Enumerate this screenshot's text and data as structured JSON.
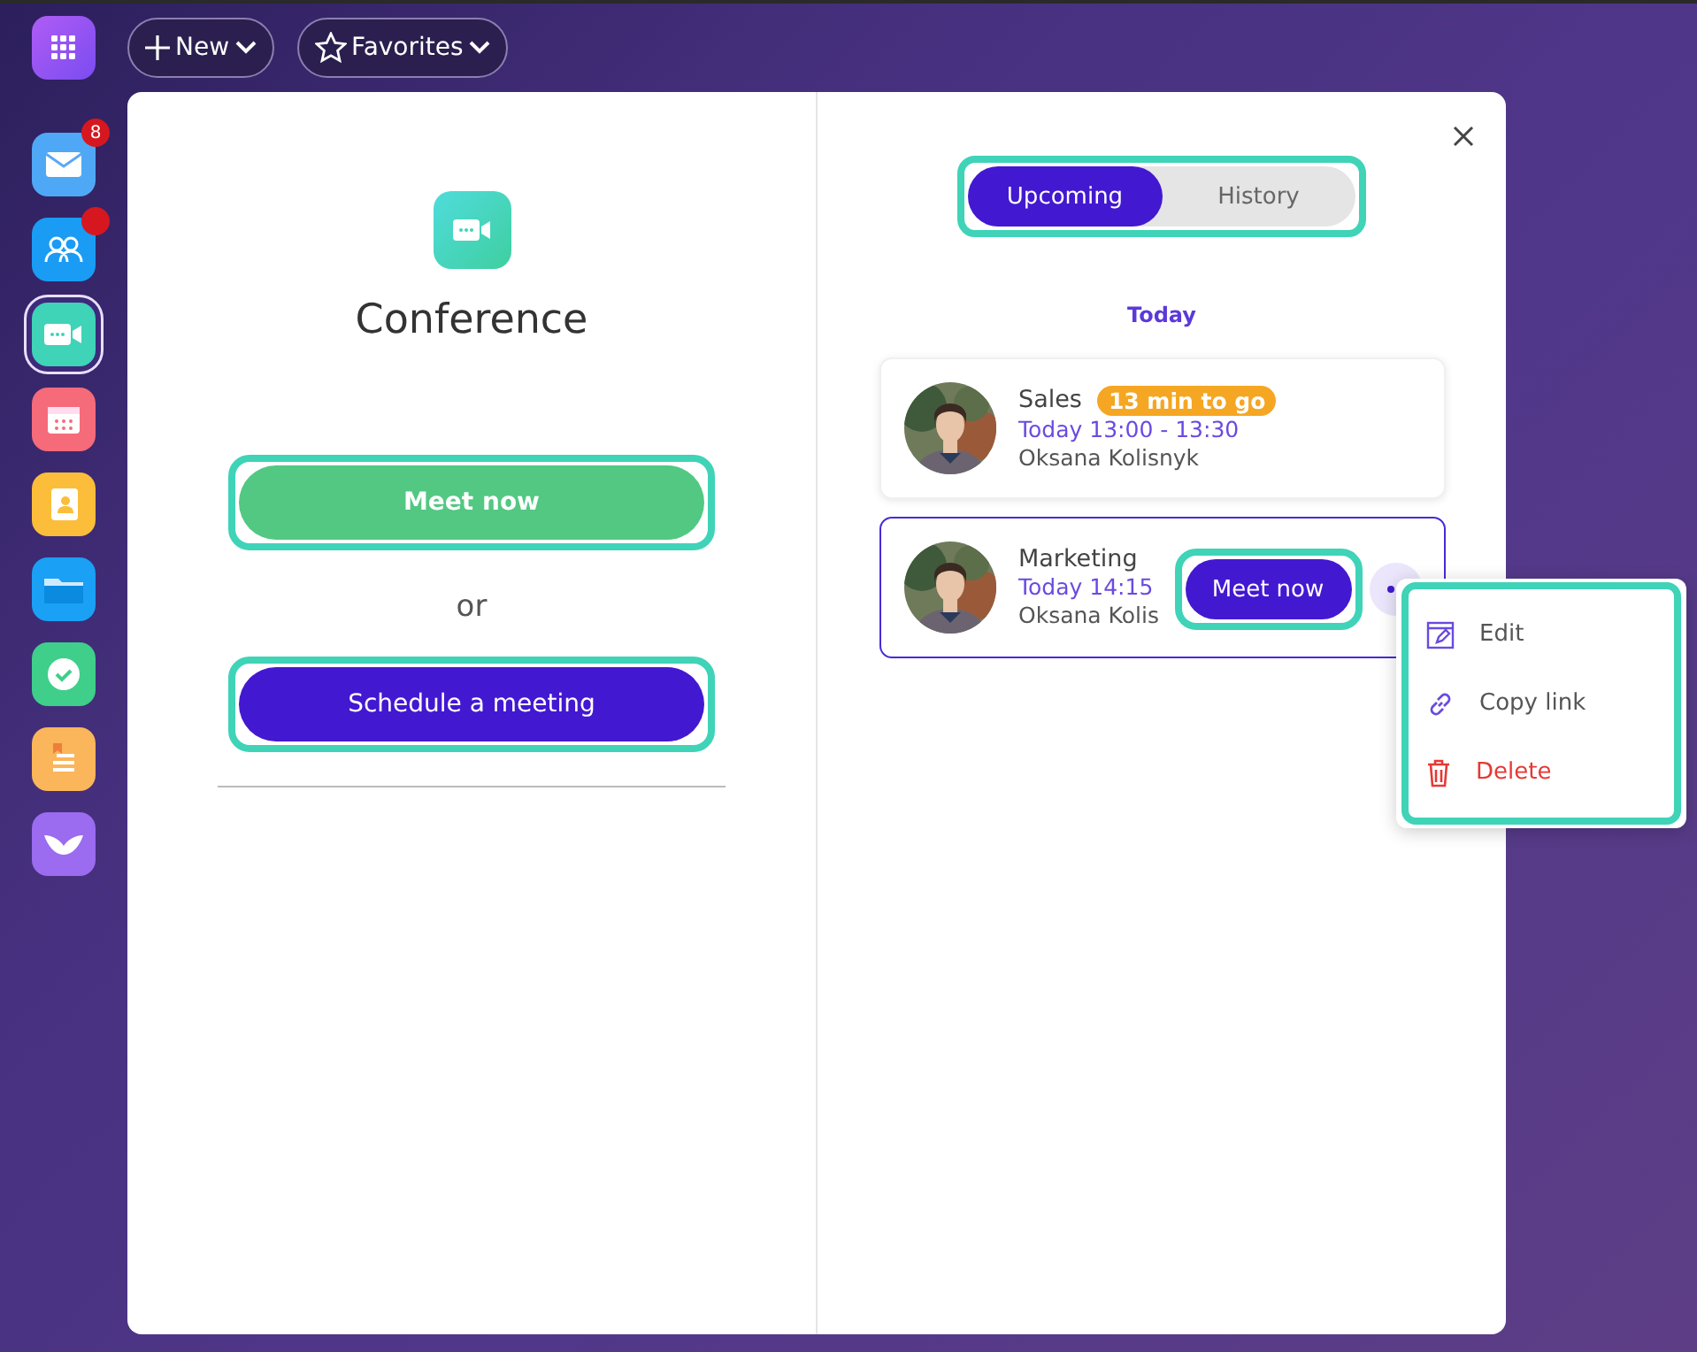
{
  "topbar": {
    "buttons": [
      {
        "label": "New",
        "kind": "new"
      },
      {
        "label": "Favorites",
        "kind": "favorites"
      }
    ]
  },
  "apps": [
    {
      "color": "#4fa8f5",
      "selected": false,
      "badge": "8"
    },
    {
      "color": "#1a9cf5",
      "selected": false,
      "dot": true
    },
    {
      "color": "#3fd3b8",
      "selected": true
    },
    {
      "color": "#f56b7a",
      "selected": false
    },
    {
      "color": "#fbbd3a",
      "selected": false
    },
    {
      "color": "#1aa0f5",
      "selected": false
    },
    {
      "color": "#3fcf8a",
      "selected": false
    },
    {
      "color": "#fbb55a",
      "selected": false
    },
    {
      "color": "#9b6bf0",
      "selected": false
    }
  ],
  "left": {
    "title": "Conference",
    "meet_button": "Meet now",
    "or": "or",
    "schedule_button": "Schedule a meeting"
  },
  "tabs": [
    {
      "label": "Upcoming",
      "selected": true
    },
    {
      "label": "History",
      "selected": false
    }
  ],
  "section": "Today",
  "meetings": [
    {
      "title": "Sales",
      "badge": "13 min to go",
      "time": "Today 13:00 - 13:30",
      "organizer": "Oksana Kolisnyk",
      "highlighted": false
    },
    {
      "title": "Marketing",
      "time": "Today 14:15",
      "organizer": "Oksana Kolis",
      "highlighted": true,
      "meet_button": "Meet now"
    }
  ],
  "menu": [
    {
      "label": "Edit",
      "kind": "edit"
    },
    {
      "label": "Copy link",
      "kind": "link"
    },
    {
      "label": "Delete",
      "kind": "delete"
    }
  ]
}
